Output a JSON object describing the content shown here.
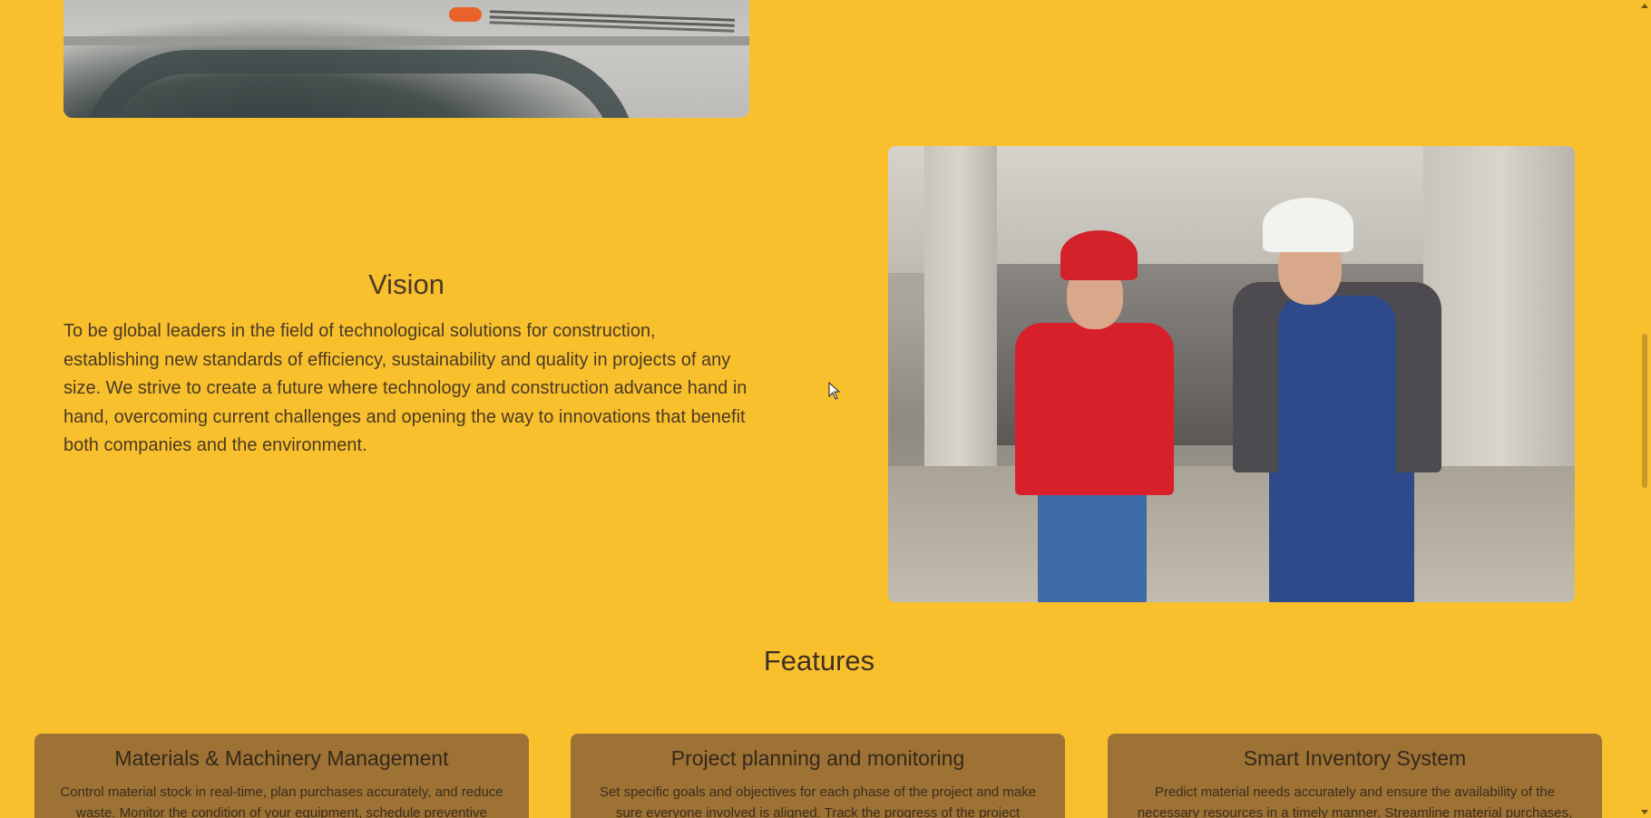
{
  "vision": {
    "title": "Vision",
    "text": "To be global leaders in the field of technological solutions for construction, establishing new standards of efficiency, sustainability and quality in projects of any size. We strive to create a future where technology and construction advance hand in hand, overcoming current challenges and opening the way to innovations that benefit both companies and the environment."
  },
  "features": {
    "title": "Features",
    "cards": [
      {
        "title": "Materials & Machinery Management",
        "text": "Control material stock in real-time, plan purchases accurately, and reduce waste. Monitor the condition of your equipment, schedule preventive"
      },
      {
        "title": "Project planning and monitoring",
        "text": "Set specific goals and objectives for each phase of the project and make sure everyone involved is aligned. Track the progress of the project"
      },
      {
        "title": "Smart Inventory System",
        "text": "Predict material needs accurately and ensure the availability of the necessary resources in a timely manner. Streamline material purchases,"
      }
    ]
  },
  "images": {
    "top": "construction-worker-photo",
    "vision": "construction-engineers-photo"
  },
  "colors": {
    "background": "#f9c02e",
    "card": "#9e7235",
    "text": "#3d3120"
  }
}
